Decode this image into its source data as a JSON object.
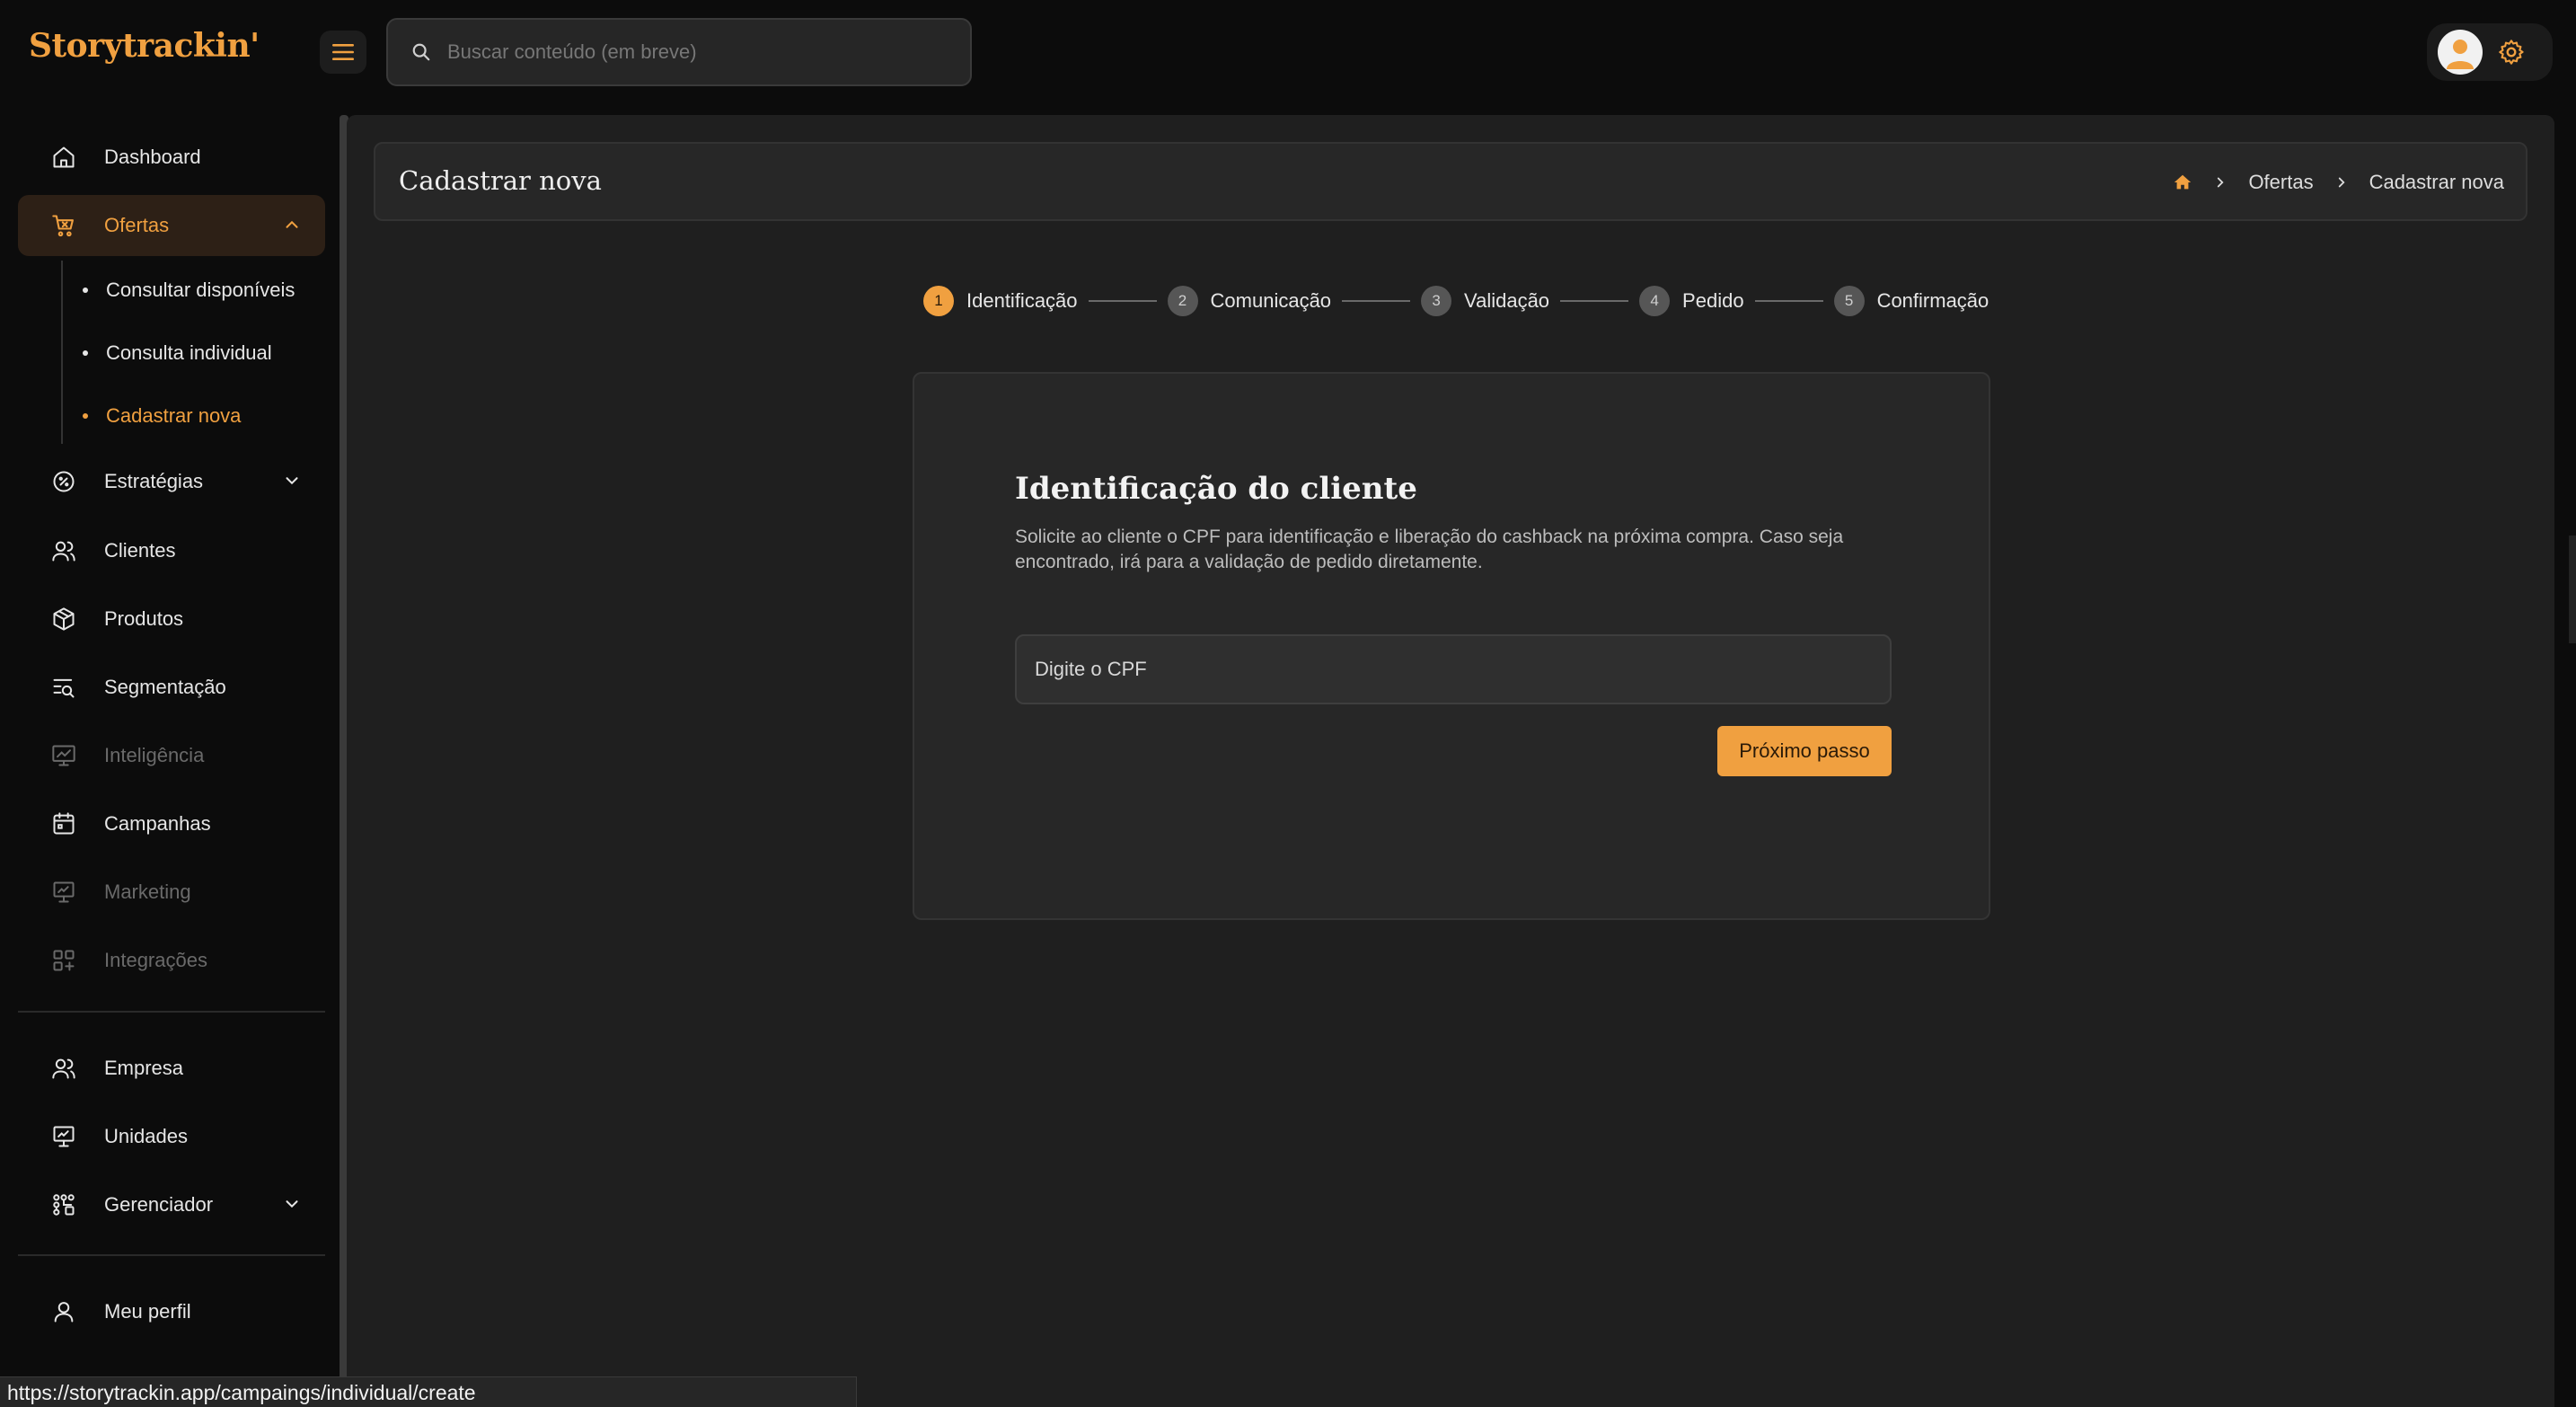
{
  "app": {
    "logo": "Storytrackin'"
  },
  "search": {
    "placeholder": "Buscar conteúdo (em breve)"
  },
  "sidebar": {
    "items": [
      {
        "label": "Dashboard"
      },
      {
        "label": "Ofertas"
      },
      {
        "label": "Estratégias"
      },
      {
        "label": "Clientes"
      },
      {
        "label": "Produtos"
      },
      {
        "label": "Segmentação"
      },
      {
        "label": "Inteligência"
      },
      {
        "label": "Campanhas"
      },
      {
        "label": "Marketing"
      },
      {
        "label": "Integrações"
      },
      {
        "label": "Empresa"
      },
      {
        "label": "Unidades"
      },
      {
        "label": "Gerenciador"
      },
      {
        "label": "Meu perfil"
      }
    ],
    "subitems": [
      {
        "label": "Consultar disponíveis"
      },
      {
        "label": "Consulta individual"
      },
      {
        "label": "Cadastrar nova"
      }
    ]
  },
  "header": {
    "title": "Cadastrar nova",
    "breadcrumb": [
      "Ofertas",
      "Cadastrar nova"
    ]
  },
  "stepper": {
    "steps": [
      {
        "num": "1",
        "label": "Identificação"
      },
      {
        "num": "2",
        "label": "Comunicação"
      },
      {
        "num": "3",
        "label": "Validação"
      },
      {
        "num": "4",
        "label": "Pedido"
      },
      {
        "num": "5",
        "label": "Confirmação"
      }
    ]
  },
  "form": {
    "title": "Identificação do cliente",
    "description": "Solicite ao cliente o CPF para identificação e liberação do cashback na próxima compra. Caso seja encontrado, irá para a validação de pedido diretamente.",
    "cpf_placeholder": "Digite o CPF",
    "next_label": "Próximo passo"
  },
  "status_bar": {
    "url": "https://storytrackin.app/campaings/individual/create"
  },
  "colors": {
    "accent": "#f0a040",
    "background": "#0c0c0c",
    "panel": "#1f1f1f",
    "card": "#272727"
  }
}
